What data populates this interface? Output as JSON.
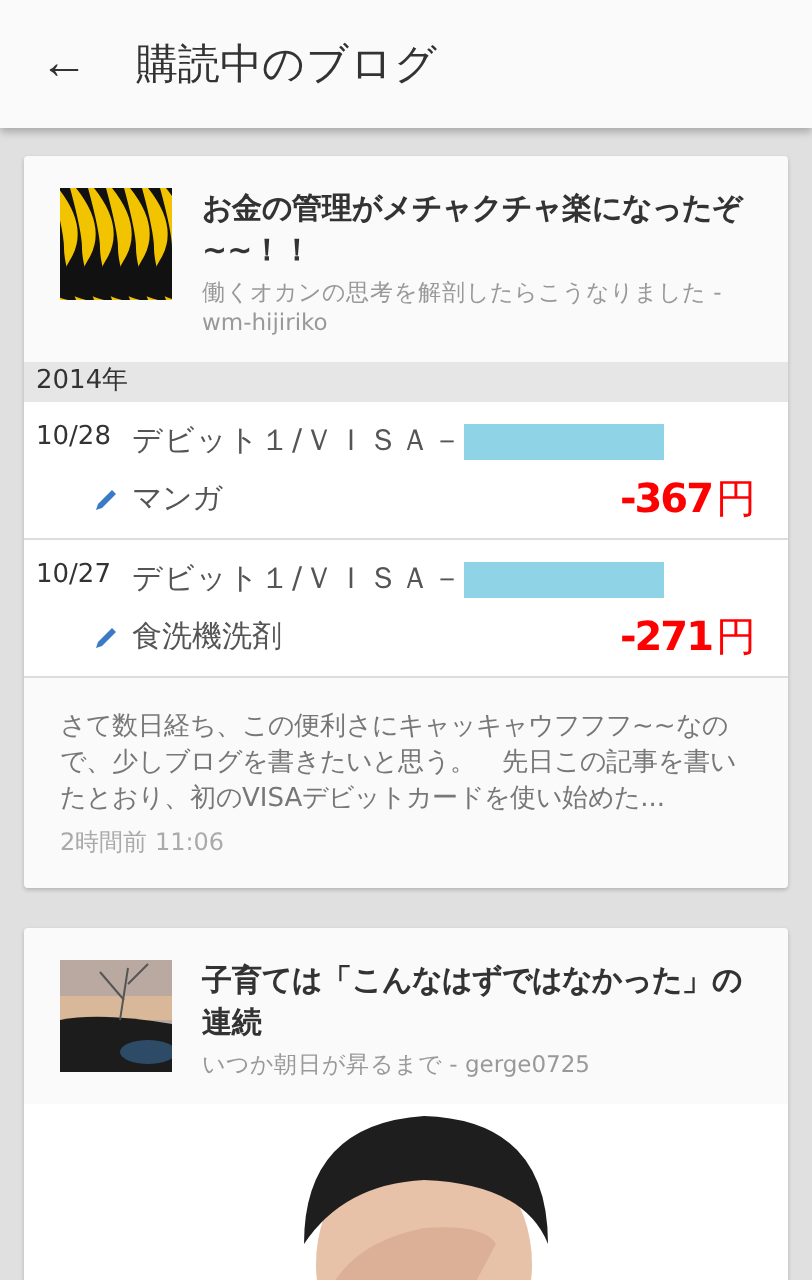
{
  "app_bar": {
    "back": "←",
    "title": "購読中のブログ"
  },
  "cards": [
    {
      "kind": "embed",
      "title": "お金の管理がメチャクチャ楽になったぞ~~！！",
      "source": "働くオカンの思考を解剖したらこうなりました - wm-hijiriko",
      "embed": {
        "year": "2014年",
        "entries": [
          {
            "date": "10/28",
            "payee": "デビット１/ＶＩＳＡ－",
            "memo": "マンガ",
            "amount": "-367",
            "unit": "円"
          },
          {
            "date": "10/27",
            "payee": "デビット１/ＶＩＳＡ－",
            "memo": "食洗機洗剤",
            "amount": "-271",
            "unit": "円"
          }
        ]
      },
      "excerpt": "さて数日経ち、この便利さにキャッキャウフフフ~~なので、少しブログを書きたいと思う。　先日この記事を書いたとおり、初のVISAデビットカードを使い始めた...",
      "time": "2時間前 11:06"
    },
    {
      "title": "子育ては「こんなはずではなかった」の連続",
      "source": "いつか朝日が昇るまで - gerge0725"
    }
  ]
}
